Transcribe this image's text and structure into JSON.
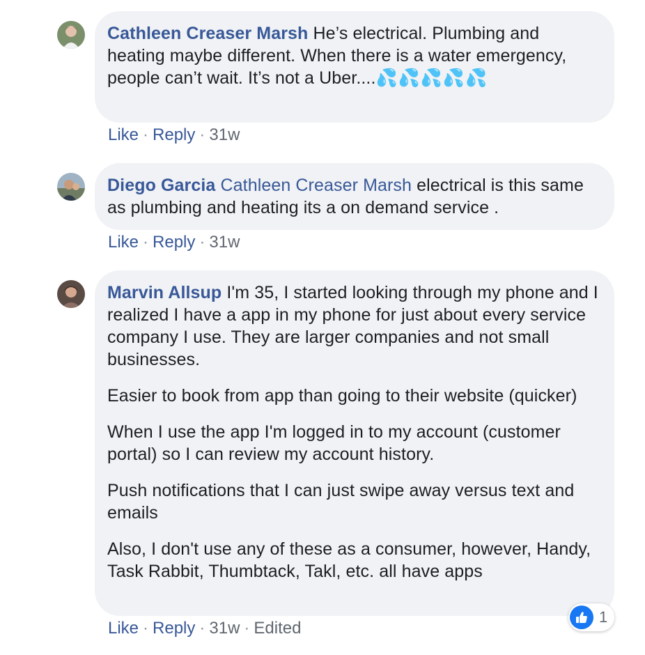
{
  "comments": [
    {
      "author": "Cathleen Creaser Marsh",
      "mention": "",
      "paragraphs": [
        "He’s electrical. Plumbing and heating maybe different. When there is a water emergency, people can’t wait. It’s not a Uber...."
      ],
      "emoji": "💦💦💦💦💦",
      "actions": {
        "like": "Like",
        "reply": "Reply",
        "time": "31w",
        "edited": ""
      }
    },
    {
      "author": "Diego Garcia",
      "mention": "Cathleen Creaser Marsh",
      "paragraphs": [
        "electrical is this same as plumbing and heating its a on demand service ."
      ],
      "actions": {
        "like": "Like",
        "reply": "Reply",
        "time": "31w",
        "edited": ""
      }
    },
    {
      "author": "Marvin Allsup",
      "mention": "",
      "paragraphs": [
        "I'm 35, I started looking through my phone and I realized I have a app in my phone for just about every service company I use. They are larger companies and not small businesses.",
        "Easier to book from app than going to their website (quicker)",
        "When I use the app I'm logged in to my account (customer portal) so I can review my account history.",
        "Push notifications that I can just swipe away versus text and emails",
        "Also, I don't use any of these as a consumer, however, Handy, Task Rabbit, Thumbtack, Takl, etc. all have apps"
      ],
      "actions": {
        "like": "Like",
        "reply": "Reply",
        "time": "31w",
        "edited": "Edited"
      },
      "reaction": {
        "icon": "thumbs-up-icon",
        "count": "1"
      }
    }
  ],
  "separator": "·",
  "colors": {
    "link": "#385898",
    "bubble": "#f0f2f5",
    "meta": "#90949c",
    "like_blue": "#1877f2"
  }
}
